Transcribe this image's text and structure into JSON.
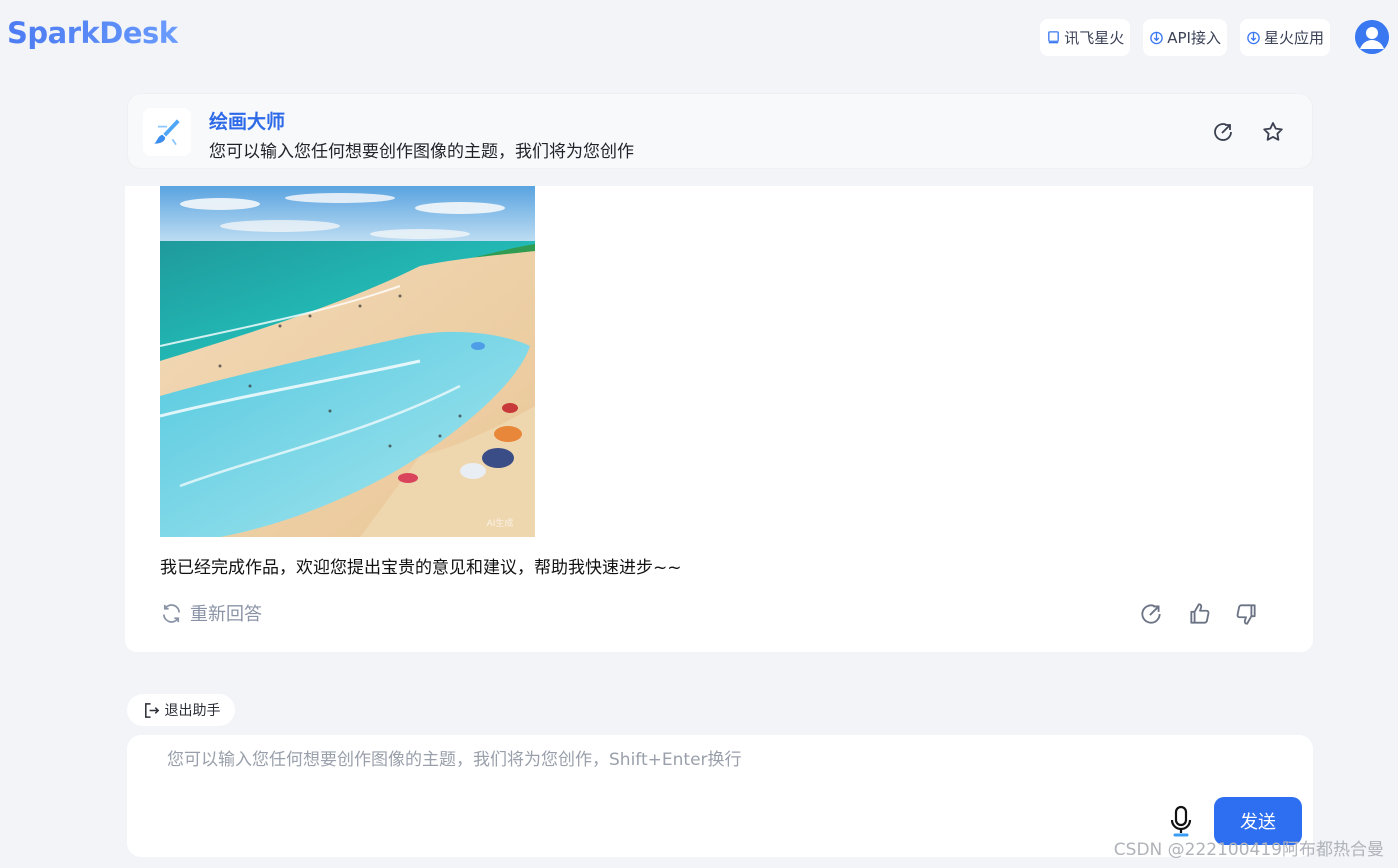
{
  "app": {
    "logo": "SparkDesk"
  },
  "top_links": [
    {
      "label": "讯飞星火",
      "icon": "book-icon"
    },
    {
      "label": "API接入",
      "icon": "download-icon"
    },
    {
      "label": "星火应用",
      "icon": "download-icon"
    }
  ],
  "assistant": {
    "name": "绘画大师",
    "description": "您可以输入您任何想要创作图像的主题，我们将为您创作"
  },
  "message": {
    "image_caption": "AI生成",
    "text": "我已经完成作品，欢迎您提出宝贵的意见和建议，帮助我快速进步~~",
    "regenerate_label": "重新回答"
  },
  "exit_label": "退出助手",
  "input": {
    "placeholder": "您可以输入您任何想要创作图像的主题，我们将为您创作，Shift+Enter换行",
    "value": ""
  },
  "send_label": "发送",
  "watermark": "CSDN @222100419阿布都热合曼",
  "colors": {
    "accent": "#2d6ff0",
    "brand": "#4d7bf3",
    "background": "#f2f4f8"
  }
}
